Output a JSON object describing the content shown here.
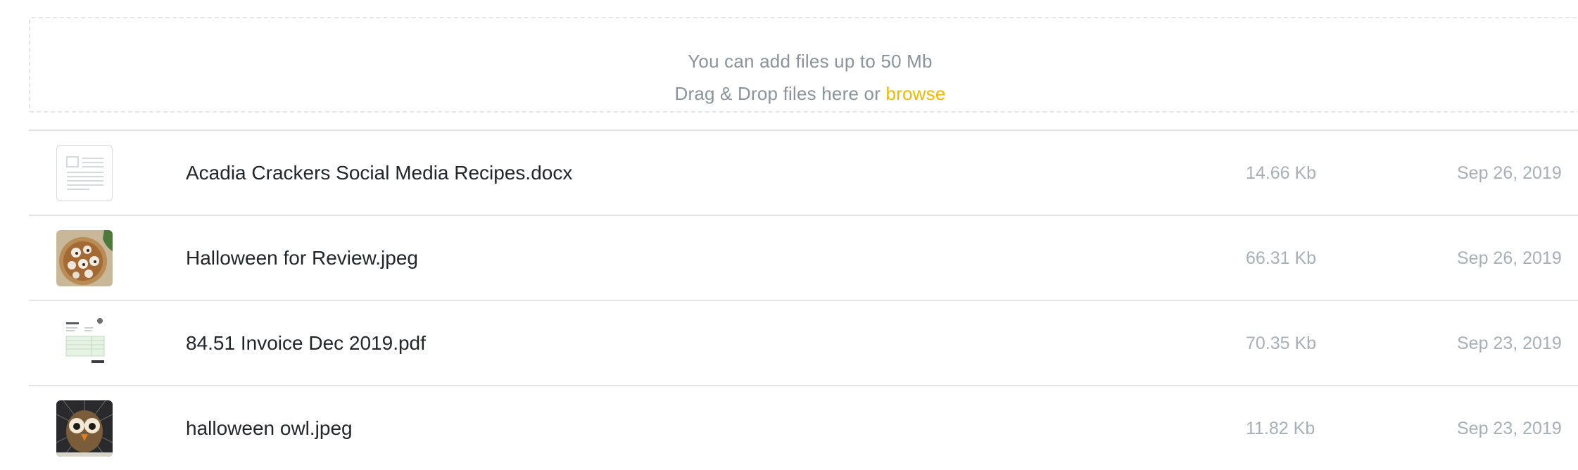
{
  "upload": {
    "limit_text": "You can add files up to 50 Mb",
    "drag_text": "Drag & Drop files here or ",
    "browse_label": "browse"
  },
  "colors": {
    "accent": "#f5b800",
    "muted_text": "#8a949b",
    "meta_text": "#a7b0b6",
    "divider": "#e1e4e6"
  },
  "files": [
    {
      "name": "Acadia Crackers Social Media Recipes.docx",
      "size": "14.66 Kb",
      "date": "Sep 26, 2019",
      "thumbnail": "document-icon"
    },
    {
      "name": "Halloween for Review.jpeg",
      "size": "66.31 Kb",
      "date": "Sep 26, 2019",
      "thumbnail": "image-thumbnail"
    },
    {
      "name": "84.51 Invoice Dec 2019.pdf",
      "size": "70.35 Kb",
      "date": "Sep 23, 2019",
      "thumbnail": "invoice-thumbnail"
    },
    {
      "name": "halloween owl.jpeg",
      "size": "11.82 Kb",
      "date": "Sep 23, 2019",
      "thumbnail": "image-thumbnail"
    }
  ]
}
